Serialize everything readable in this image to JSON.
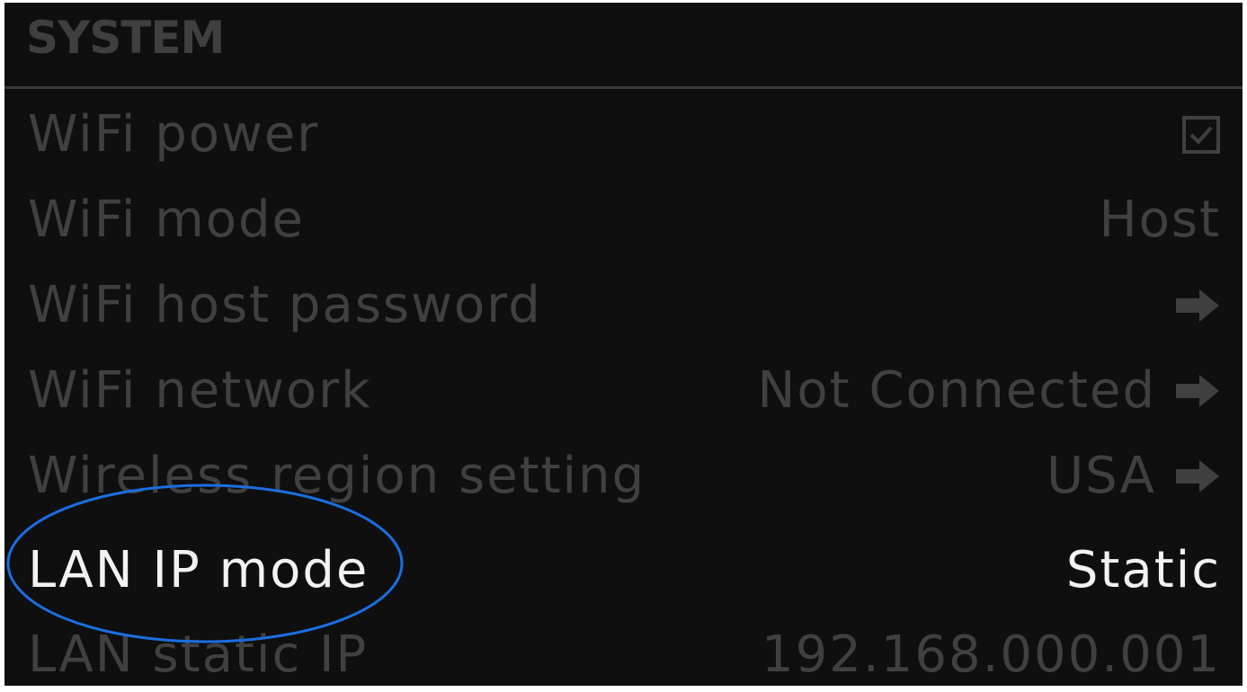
{
  "section": {
    "title": "SYSTEM"
  },
  "rows": [
    {
      "label": "WiFi power",
      "value": "",
      "value_icon": "checkbox-checked-icon",
      "active": false
    },
    {
      "label": "WiFi mode",
      "value": "Host",
      "value_icon": "",
      "active": false
    },
    {
      "label": "WiFi host password",
      "value": "",
      "value_icon": "arrow-right-icon",
      "active": false
    },
    {
      "label": "WiFi network",
      "value": "Not Connected",
      "value_icon": "arrow-right-icon",
      "active": false
    },
    {
      "label": "Wireless region setting",
      "value": "USA",
      "value_icon": "arrow-right-icon",
      "active": false
    },
    {
      "label": "LAN IP mode",
      "value": "Static",
      "value_icon": "",
      "active": true
    },
    {
      "label": "LAN static IP",
      "value": "192.168.000.001",
      "value_icon": "",
      "active": false
    }
  ],
  "colors": {
    "background": "#0f0f0f",
    "inactive_text": "#404040",
    "active_text": "#f2f2f2",
    "highlight_annotation": "#1a6fe0"
  }
}
